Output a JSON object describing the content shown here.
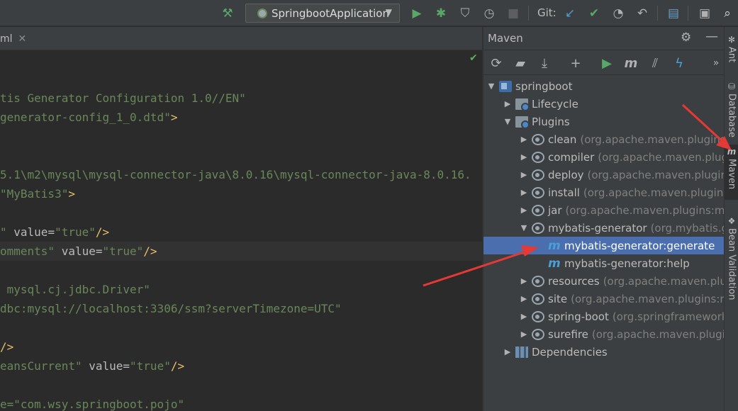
{
  "toolbar": {
    "run_config": "SpringbootApplication",
    "git_label": "Git:"
  },
  "editor": {
    "tab_label": "ml",
    "lines": [
      {
        "type": "plain",
        "text": "tis Generator Configuration 1.0//EN\""
      },
      {
        "type": "mixed",
        "parts": [
          [
            "str",
            "generator-config_1_0.dtd\""
          ],
          [
            "tag",
            ">"
          ]
        ]
      },
      {
        "type": "plain",
        "text": "5.1\\m2\\mysql\\mysql-connector-java\\8.0.16\\mysql-connector-java-8.0.16."
      },
      {
        "type": "mixed",
        "parts": [
          [
            "str",
            "\"MyBatis3\""
          ],
          [
            "tag",
            ">"
          ]
        ]
      },
      {
        "type": "mixed",
        "parts": [
          [
            "str",
            "\""
          ],
          [
            "attr",
            " value="
          ],
          [
            "str",
            "\"true\""
          ],
          [
            "tag",
            "/>"
          ]
        ]
      },
      {
        "type": "mixed",
        "parts": [
          [
            "str",
            "omments\""
          ],
          [
            "attr",
            " value="
          ],
          [
            "str",
            "\"true\""
          ],
          [
            "tag",
            "/>"
          ]
        ]
      },
      {
        "type": "mixed",
        "parts": [
          [
            "str",
            " mysql.cj.jdbc.Driver\""
          ]
        ]
      },
      {
        "type": "mixed",
        "parts": [
          [
            "str",
            "dbc:mysql://localhost:3306/ssm?serverTimezone=UTC\""
          ]
        ]
      },
      {
        "type": "mixed",
        "parts": [
          [
            "tag",
            "/>"
          ]
        ]
      },
      {
        "type": "mixed",
        "parts": [
          [
            "str",
            "eansCurrent\""
          ],
          [
            "attr",
            " value="
          ],
          [
            "str",
            "\"true\""
          ],
          [
            "tag",
            "/>"
          ]
        ]
      },
      {
        "type": "mixed",
        "parts": [
          [
            "str",
            "e=\"com.wsy.springboot.pojo\""
          ]
        ]
      }
    ]
  },
  "maven": {
    "title": "Maven",
    "tree": [
      {
        "level": 0,
        "expanded": true,
        "icon": "module",
        "label": "springboot",
        "detail": ""
      },
      {
        "level": 1,
        "expanded": false,
        "icon": "folder",
        "label": "Lifecycle",
        "detail": ""
      },
      {
        "level": 1,
        "expanded": true,
        "icon": "folder",
        "label": "Plugins",
        "detail": ""
      },
      {
        "level": 2,
        "expanded": false,
        "icon": "plugin",
        "label": "clean",
        "detail": "(org.apache.maven.plugins:ma"
      },
      {
        "level": 2,
        "expanded": false,
        "icon": "plugin",
        "label": "compiler",
        "detail": "(org.apache.maven.plugins"
      },
      {
        "level": 2,
        "expanded": false,
        "icon": "plugin",
        "label": "deploy",
        "detail": "(org.apache.maven.plugins:m"
      },
      {
        "level": 2,
        "expanded": false,
        "icon": "plugin",
        "label": "install",
        "detail": "(org.apache.maven.plugins:ma"
      },
      {
        "level": 2,
        "expanded": false,
        "icon": "plugin",
        "label": "jar",
        "detail": "(org.apache.maven.plugins:maver"
      },
      {
        "level": 2,
        "expanded": true,
        "icon": "plugin",
        "label": "mybatis-generator",
        "detail": "(org.mybatis.gene"
      },
      {
        "level": 3,
        "leaf": true,
        "icon": "goal",
        "label": "mybatis-generator:generate",
        "detail": "",
        "selected": true
      },
      {
        "level": 3,
        "leaf": true,
        "icon": "goal",
        "label": "mybatis-generator:help",
        "detail": ""
      },
      {
        "level": 2,
        "expanded": false,
        "icon": "plugin",
        "label": "resources",
        "detail": "(org.apache.maven.plugins:"
      },
      {
        "level": 2,
        "expanded": false,
        "icon": "plugin",
        "label": "site",
        "detail": "(org.apache.maven.plugins:mave"
      },
      {
        "level": 2,
        "expanded": false,
        "icon": "plugin",
        "label": "spring-boot",
        "detail": "(org.springframework.bo"
      },
      {
        "level": 2,
        "expanded": false,
        "icon": "plugin",
        "label": "surefire",
        "detail": "(org.apache.maven.plugins:r"
      },
      {
        "level": 1,
        "expanded": false,
        "icon": "deps",
        "label": "Dependencies",
        "detail": ""
      }
    ]
  },
  "stripe": {
    "items": [
      {
        "label": "Ant",
        "icon": "ant-icon"
      },
      {
        "label": "Database",
        "icon": "database-icon"
      },
      {
        "label": "Maven",
        "icon": "maven-icon",
        "active": true
      },
      {
        "label": "Bean Validation",
        "icon": "bean-validation-icon"
      }
    ]
  },
  "icons": {
    "hammer": "hammer-icon",
    "run": "run-icon",
    "debug": "debug-icon",
    "coverage": "coverage-icon",
    "profile": "profile-icon",
    "stop": "stop-icon",
    "git_update": "git-update-icon",
    "git_commit": "git-commit-icon",
    "history": "history-icon",
    "rollback": "rollback-icon",
    "project_structure": "project-structure-icon",
    "terminal": "terminal-icon",
    "search": "search-icon"
  },
  "colors": {
    "accent_selection": "#4b6eaf",
    "annotation_arrow": "#e53935",
    "run_green": "#59a869"
  }
}
